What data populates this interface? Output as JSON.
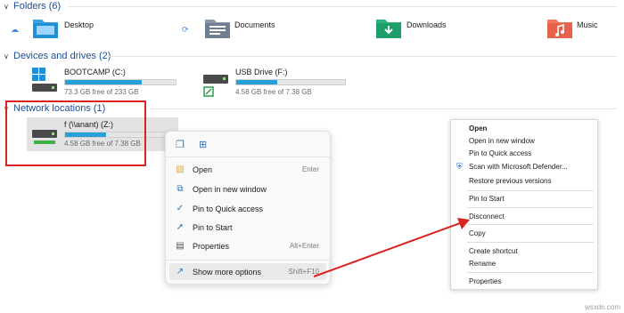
{
  "sections": {
    "folders": "Folders (6)",
    "devices": "Devices and drives (2)",
    "network": "Network locations (1)"
  },
  "folders": [
    {
      "label": "Desktop",
      "icon": "desktop-folder-icon",
      "color": "#1f8fd6"
    },
    {
      "label": "Documents",
      "icon": "documents-folder-icon",
      "color": "#6f7f91"
    },
    {
      "label": "Downloads",
      "icon": "downloads-folder-icon",
      "color": "#1e9e6a"
    },
    {
      "label": "Music",
      "icon": "music-folder-icon",
      "color": "#e8614b"
    }
  ],
  "drives": [
    {
      "name": "BOOTCAMP (C:)",
      "free": "73.3 GB free of 233 GB",
      "used_fraction": 0.69
    },
    {
      "name": "USB Drive (F:)",
      "free": "4.58 GB free of 7.38 GB",
      "used_fraction": 0.38
    }
  ],
  "network_drive": {
    "name": "f (\\\\anant) (Z:)",
    "free": "4.58 GB free of 7.38 GB",
    "used_fraction": 0.38
  },
  "context_menu": {
    "items": [
      {
        "label": "Open",
        "shortcut": "Enter",
        "icon": "open-folder-icon"
      },
      {
        "label": "Open in new window",
        "shortcut": "",
        "icon": "new-window-icon"
      },
      {
        "label": "Pin to Quick access",
        "shortcut": "",
        "icon": "pin-icon"
      },
      {
        "label": "Pin to Start",
        "shortcut": "",
        "icon": "pin-start-icon"
      },
      {
        "label": "Properties",
        "shortcut": "Alt+Enter",
        "icon": "properties-icon"
      },
      {
        "label": "Show more options",
        "shortcut": "Shift+F10",
        "icon": "more-options-icon"
      }
    ]
  },
  "classic_menu": {
    "items": [
      "Open",
      "Open in new window",
      "Pin to Quick access",
      "Scan with Microsoft Defender...",
      "Restore previous versions",
      "Pin to Start",
      "Disconnect",
      "Copy",
      "Create shortcut",
      "Rename",
      "Properties"
    ]
  },
  "watermark": "wsxdn.com",
  "colors": {
    "accent": "#26a0da",
    "highlight": "#d8231f",
    "header": "#1a4fa0"
  }
}
